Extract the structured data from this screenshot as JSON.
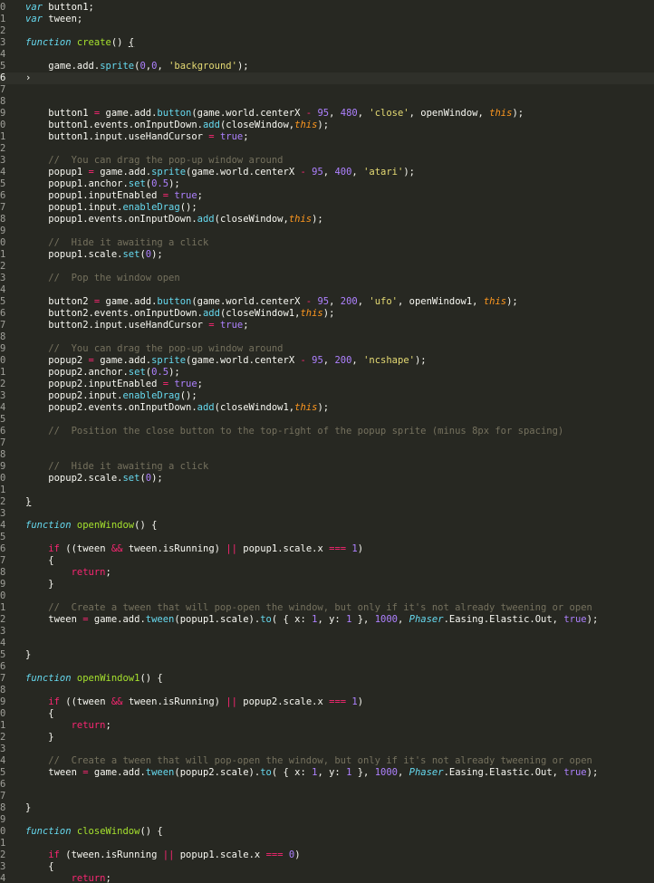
{
  "editor": {
    "theme": "monokai",
    "colors": {
      "background": "#272822",
      "keyword": "#f92672",
      "storage": "#66d9ef",
      "function": "#a6e22e",
      "string": "#e6db74",
      "number": "#ae81ff",
      "comment": "#75715e",
      "this": "#fd971f"
    },
    "current_line": 6,
    "lines": [
      [
        [
          "0",
          "ln"
        ],
        [
          "var",
          "st"
        ],
        [
          " button1;",
          ""
        ]
      ],
      [
        [
          "1",
          "ln"
        ],
        [
          "var",
          "st"
        ],
        [
          " tween;",
          ""
        ]
      ],
      [
        [
          "2",
          "ln"
        ]
      ],
      [
        [
          "3",
          "ln"
        ],
        [
          "function",
          "st"
        ],
        [
          " ",
          ""
        ],
        [
          "create",
          "fn"
        ],
        [
          "() ",
          ""
        ],
        [
          "{",
          "ul"
        ]
      ],
      [
        [
          "4",
          "ln"
        ]
      ],
      [
        [
          "5",
          "ln"
        ],
        [
          "    game.add.",
          ""
        ],
        [
          "sprite",
          "prop"
        ],
        [
          "(",
          ""
        ],
        [
          "0",
          "num"
        ],
        [
          ",",
          ""
        ],
        [
          "0",
          "num"
        ],
        [
          ", ",
          ""
        ],
        [
          "'background'",
          "str"
        ],
        [
          ");",
          ""
        ]
      ],
      [
        [
          "6",
          "ln"
        ],
        [
          "›",
          "arrow"
        ]
      ],
      [
        [
          "7",
          "ln"
        ]
      ],
      [
        [
          "8",
          "ln"
        ]
      ],
      [
        [
          "9",
          "ln"
        ],
        [
          "    button1 ",
          ""
        ],
        [
          "=",
          "op"
        ],
        [
          " game.add.",
          ""
        ],
        [
          "button",
          "prop"
        ],
        [
          "(game.world.centerX ",
          ""
        ],
        [
          "-",
          "op"
        ],
        [
          " ",
          ""
        ],
        [
          "95",
          "num"
        ],
        [
          ", ",
          ""
        ],
        [
          "480",
          "num"
        ],
        [
          ", ",
          ""
        ],
        [
          "'close'",
          "str"
        ],
        [
          ", openWindow, ",
          ""
        ],
        [
          "this",
          "this"
        ],
        [
          ");",
          ""
        ]
      ],
      [
        [
          "0",
          "ln"
        ],
        [
          "    button1.events.onInputDown.",
          ""
        ],
        [
          "add",
          "prop"
        ],
        [
          "(closeWindow,",
          ""
        ],
        [
          "this",
          "this"
        ],
        [
          ");",
          ""
        ]
      ],
      [
        [
          "1",
          "ln"
        ],
        [
          "    button1.input.useHandCursor ",
          ""
        ],
        [
          "=",
          "op"
        ],
        [
          " ",
          ""
        ],
        [
          "true",
          "num"
        ],
        [
          ";",
          ""
        ]
      ],
      [
        [
          "2",
          "ln"
        ]
      ],
      [
        [
          "3",
          "ln"
        ],
        [
          "    //  You can drag the pop-up window around",
          "com"
        ]
      ],
      [
        [
          "4",
          "ln"
        ],
        [
          "    popup1 ",
          ""
        ],
        [
          "=",
          "op"
        ],
        [
          " game.add.",
          ""
        ],
        [
          "sprite",
          "prop"
        ],
        [
          "(game.world.centerX ",
          ""
        ],
        [
          "-",
          "op"
        ],
        [
          " ",
          ""
        ],
        [
          "95",
          "num"
        ],
        [
          ", ",
          ""
        ],
        [
          "400",
          "num"
        ],
        [
          ", ",
          ""
        ],
        [
          "'atari'",
          "str"
        ],
        [
          ");",
          ""
        ]
      ],
      [
        [
          "5",
          "ln"
        ],
        [
          "    popup1.anchor.",
          ""
        ],
        [
          "set",
          "prop"
        ],
        [
          "(",
          ""
        ],
        [
          "0.5",
          "num"
        ],
        [
          ");",
          ""
        ]
      ],
      [
        [
          "6",
          "ln"
        ],
        [
          "    popup1.inputEnabled ",
          ""
        ],
        [
          "=",
          "op"
        ],
        [
          " ",
          ""
        ],
        [
          "true",
          "num"
        ],
        [
          ";",
          ""
        ]
      ],
      [
        [
          "7",
          "ln"
        ],
        [
          "    popup1.input.",
          ""
        ],
        [
          "enableDrag",
          "prop"
        ],
        [
          "();",
          ""
        ]
      ],
      [
        [
          "8",
          "ln"
        ],
        [
          "    popup1.events.onInputDown.",
          ""
        ],
        [
          "add",
          "prop"
        ],
        [
          "(closeWindow,",
          ""
        ],
        [
          "this",
          "this"
        ],
        [
          ");",
          ""
        ]
      ],
      [
        [
          "9",
          "ln"
        ]
      ],
      [
        [
          "0",
          "ln"
        ],
        [
          "    //  Hide it awaiting a click",
          "com"
        ]
      ],
      [
        [
          "1",
          "ln"
        ],
        [
          "    popup1.scale.",
          ""
        ],
        [
          "set",
          "prop"
        ],
        [
          "(",
          ""
        ],
        [
          "0",
          "num"
        ],
        [
          ");",
          ""
        ]
      ],
      [
        [
          "2",
          "ln"
        ]
      ],
      [
        [
          "3",
          "ln"
        ],
        [
          "    //  Pop the window open",
          "com"
        ]
      ],
      [
        [
          "4",
          "ln"
        ]
      ],
      [
        [
          "5",
          "ln"
        ],
        [
          "    button2 ",
          ""
        ],
        [
          "=",
          "op"
        ],
        [
          " game.add.",
          ""
        ],
        [
          "button",
          "prop"
        ],
        [
          "(game.world.centerX ",
          ""
        ],
        [
          "-",
          "op"
        ],
        [
          " ",
          ""
        ],
        [
          "95",
          "num"
        ],
        [
          ", ",
          ""
        ],
        [
          "200",
          "num"
        ],
        [
          ", ",
          ""
        ],
        [
          "'ufo'",
          "str"
        ],
        [
          ", openWindow1, ",
          ""
        ],
        [
          "this",
          "this"
        ],
        [
          ");",
          ""
        ]
      ],
      [
        [
          "6",
          "ln"
        ],
        [
          "    button2.events.onInputDown.",
          ""
        ],
        [
          "add",
          "prop"
        ],
        [
          "(closeWindow1,",
          ""
        ],
        [
          "this",
          "this"
        ],
        [
          ");",
          ""
        ]
      ],
      [
        [
          "7",
          "ln"
        ],
        [
          "    button2.input.useHandCursor ",
          ""
        ],
        [
          "=",
          "op"
        ],
        [
          " ",
          ""
        ],
        [
          "true",
          "num"
        ],
        [
          ";",
          ""
        ]
      ],
      [
        [
          "8",
          "ln"
        ]
      ],
      [
        [
          "9",
          "ln"
        ],
        [
          "    //  You can drag the pop-up window around",
          "com"
        ]
      ],
      [
        [
          "0",
          "ln"
        ],
        [
          "    popup2 ",
          ""
        ],
        [
          "=",
          "op"
        ],
        [
          " game.add.",
          ""
        ],
        [
          "sprite",
          "prop"
        ],
        [
          "(game.world.centerX ",
          ""
        ],
        [
          "-",
          "op"
        ],
        [
          " ",
          ""
        ],
        [
          "95",
          "num"
        ],
        [
          ", ",
          ""
        ],
        [
          "200",
          "num"
        ],
        [
          ", ",
          ""
        ],
        [
          "'ncshape'",
          "str"
        ],
        [
          ");",
          ""
        ]
      ],
      [
        [
          "1",
          "ln"
        ],
        [
          "    popup2.anchor.",
          ""
        ],
        [
          "set",
          "prop"
        ],
        [
          "(",
          ""
        ],
        [
          "0.5",
          "num"
        ],
        [
          ");",
          ""
        ]
      ],
      [
        [
          "2",
          "ln"
        ],
        [
          "    popup2.inputEnabled ",
          ""
        ],
        [
          "=",
          "op"
        ],
        [
          " ",
          ""
        ],
        [
          "true",
          "num"
        ],
        [
          ";",
          ""
        ]
      ],
      [
        [
          "3",
          "ln"
        ],
        [
          "    popup2.input.",
          ""
        ],
        [
          "enableDrag",
          "prop"
        ],
        [
          "();",
          ""
        ]
      ],
      [
        [
          "4",
          "ln"
        ],
        [
          "    popup2.events.onInputDown.",
          ""
        ],
        [
          "add",
          "prop"
        ],
        [
          "(closeWindow1,",
          ""
        ],
        [
          "this",
          "this"
        ],
        [
          ");",
          ""
        ]
      ],
      [
        [
          "5",
          "ln"
        ]
      ],
      [
        [
          "6",
          "ln"
        ],
        [
          "    //  Position the close button to the top-right of the popup sprite (minus 8px for spacing)",
          "com"
        ]
      ],
      [
        [
          "7",
          "ln"
        ]
      ],
      [
        [
          "8",
          "ln"
        ]
      ],
      [
        [
          "9",
          "ln"
        ],
        [
          "    //  Hide it awaiting a click",
          "com"
        ]
      ],
      [
        [
          "0",
          "ln"
        ],
        [
          "    popup2.scale.",
          ""
        ],
        [
          "set",
          "prop"
        ],
        [
          "(",
          ""
        ],
        [
          "0",
          "num"
        ],
        [
          ");",
          ""
        ]
      ],
      [
        [
          "1",
          "ln"
        ]
      ],
      [
        [
          "2",
          "ln"
        ],
        [
          "}",
          "ul"
        ]
      ],
      [
        [
          "3",
          "ln"
        ]
      ],
      [
        [
          "4",
          "ln"
        ],
        [
          "function",
          "st"
        ],
        [
          " ",
          ""
        ],
        [
          "openWindow",
          "fn"
        ],
        [
          "() {",
          ""
        ]
      ],
      [
        [
          "5",
          "ln"
        ]
      ],
      [
        [
          "6",
          "ln"
        ],
        [
          "    ",
          ""
        ],
        [
          "if",
          "kw"
        ],
        [
          " ((tween ",
          ""
        ],
        [
          "&&",
          "op"
        ],
        [
          " tween.isRunning) ",
          ""
        ],
        [
          "||",
          "op"
        ],
        [
          " popup1.scale.x ",
          ""
        ],
        [
          "===",
          "op"
        ],
        [
          " ",
          ""
        ],
        [
          "1",
          "num"
        ],
        [
          ")",
          ""
        ]
      ],
      [
        [
          "7",
          "ln"
        ],
        [
          "    {",
          ""
        ]
      ],
      [
        [
          "8",
          "ln"
        ],
        [
          "        ",
          ""
        ],
        [
          "return",
          "kw"
        ],
        [
          ";",
          ""
        ]
      ],
      [
        [
          "9",
          "ln"
        ],
        [
          "    }",
          ""
        ]
      ],
      [
        [
          "0",
          "ln"
        ]
      ],
      [
        [
          "1",
          "ln"
        ],
        [
          "    //  Create a tween that will pop-open the window, but only if it's not already tweening or open",
          "com"
        ]
      ],
      [
        [
          "2",
          "ln"
        ],
        [
          "    tween ",
          ""
        ],
        [
          "=",
          "op"
        ],
        [
          " game.add.",
          ""
        ],
        [
          "tween",
          "prop"
        ],
        [
          "(popup1.scale).",
          ""
        ],
        [
          "to",
          "prop"
        ],
        [
          "( { x: ",
          ""
        ],
        [
          "1",
          "num"
        ],
        [
          ", y: ",
          ""
        ],
        [
          "1",
          "num"
        ],
        [
          " }, ",
          ""
        ],
        [
          "1000",
          "num"
        ],
        [
          ", ",
          ""
        ],
        [
          "Phaser",
          "cls"
        ],
        [
          ".Easing.Elastic.Out, ",
          ""
        ],
        [
          "true",
          "num"
        ],
        [
          ");",
          ""
        ]
      ],
      [
        [
          "3",
          "ln"
        ]
      ],
      [
        [
          "4",
          "ln"
        ]
      ],
      [
        [
          "5",
          "ln"
        ],
        [
          "}",
          ""
        ]
      ],
      [
        [
          "6",
          "ln"
        ]
      ],
      [
        [
          "7",
          "ln"
        ],
        [
          "function",
          "st"
        ],
        [
          " ",
          ""
        ],
        [
          "openWindow1",
          "fn"
        ],
        [
          "() {",
          ""
        ]
      ],
      [
        [
          "8",
          "ln"
        ]
      ],
      [
        [
          "9",
          "ln"
        ],
        [
          "    ",
          ""
        ],
        [
          "if",
          "kw"
        ],
        [
          " ((tween ",
          ""
        ],
        [
          "&&",
          "op"
        ],
        [
          " tween.isRunning) ",
          ""
        ],
        [
          "||",
          "op"
        ],
        [
          " popup2.scale.x ",
          ""
        ],
        [
          "===",
          "op"
        ],
        [
          " ",
          ""
        ],
        [
          "1",
          "num"
        ],
        [
          ")",
          ""
        ]
      ],
      [
        [
          "0",
          "ln"
        ],
        [
          "    {",
          ""
        ]
      ],
      [
        [
          "1",
          "ln"
        ],
        [
          "        ",
          ""
        ],
        [
          "return",
          "kw"
        ],
        [
          ";",
          ""
        ]
      ],
      [
        [
          "2",
          "ln"
        ],
        [
          "    }",
          ""
        ]
      ],
      [
        [
          "3",
          "ln"
        ]
      ],
      [
        [
          "4",
          "ln"
        ],
        [
          "    //  Create a tween that will pop-open the window, but only if it's not already tweening or open",
          "com"
        ]
      ],
      [
        [
          "5",
          "ln"
        ],
        [
          "    tween ",
          ""
        ],
        [
          "=",
          "op"
        ],
        [
          " game.add.",
          ""
        ],
        [
          "tween",
          "prop"
        ],
        [
          "(popup2.scale).",
          ""
        ],
        [
          "to",
          "prop"
        ],
        [
          "( { x: ",
          ""
        ],
        [
          "1",
          "num"
        ],
        [
          ", y: ",
          ""
        ],
        [
          "1",
          "num"
        ],
        [
          " }, ",
          ""
        ],
        [
          "1000",
          "num"
        ],
        [
          ", ",
          ""
        ],
        [
          "Phaser",
          "cls"
        ],
        [
          ".Easing.Elastic.Out, ",
          ""
        ],
        [
          "true",
          "num"
        ],
        [
          ");",
          ""
        ]
      ],
      [
        [
          "6",
          "ln"
        ]
      ],
      [
        [
          "7",
          "ln"
        ]
      ],
      [
        [
          "8",
          "ln"
        ],
        [
          "}",
          ""
        ]
      ],
      [
        [
          "9",
          "ln"
        ]
      ],
      [
        [
          "0",
          "ln"
        ],
        [
          "function",
          "st"
        ],
        [
          " ",
          ""
        ],
        [
          "closeWindow",
          "fn"
        ],
        [
          "() {",
          ""
        ]
      ],
      [
        [
          "1",
          "ln"
        ]
      ],
      [
        [
          "2",
          "ln"
        ],
        [
          "    ",
          ""
        ],
        [
          "if",
          "kw"
        ],
        [
          " (tween.isRunning ",
          ""
        ],
        [
          "||",
          "op"
        ],
        [
          " popup1.scale.x ",
          ""
        ],
        [
          "===",
          "op"
        ],
        [
          " ",
          ""
        ],
        [
          "0",
          "num"
        ],
        [
          ")",
          ""
        ]
      ],
      [
        [
          "3",
          "ln"
        ],
        [
          "    {",
          ""
        ]
      ],
      [
        [
          "4",
          "ln"
        ],
        [
          "        ",
          ""
        ],
        [
          "return",
          "kw"
        ],
        [
          ";",
          ""
        ]
      ]
    ]
  }
}
